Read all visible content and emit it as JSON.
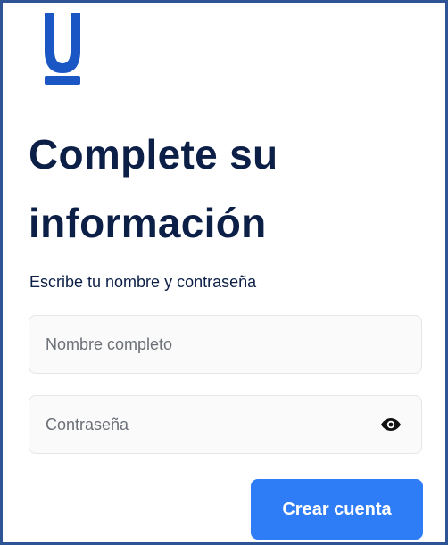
{
  "brand": {
    "logo_icon": "u-logo-icon",
    "color": "#1a56c4"
  },
  "page": {
    "title": "Complete su información",
    "subtitle": "Escribe tu nombre y contraseña"
  },
  "form": {
    "name_field": {
      "placeholder": "Nombre completo",
      "value": ""
    },
    "password_field": {
      "placeholder": "Contraseña",
      "value": "",
      "toggle_icon": "eye-icon"
    },
    "submit_label": "Crear cuenta"
  },
  "colors": {
    "heading": "#0c1f47",
    "button": "#2f7df6",
    "frame_border": "#2f5496"
  }
}
